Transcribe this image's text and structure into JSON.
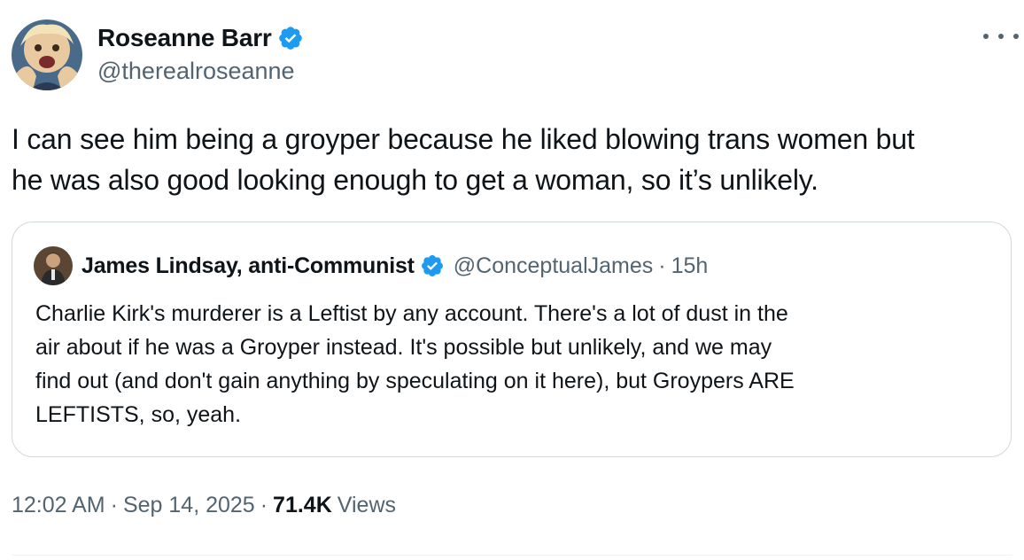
{
  "author": {
    "display_name": "Roseanne Barr",
    "handle": "@therealroseanne",
    "verified": true,
    "avatar_icon": "profile-photo"
  },
  "more_icon": "ellipsis-icon",
  "tweet": {
    "text_line1": "I can see him being a groyper because he liked blowing trans women but",
    "text_line2": "he was also good looking enough to get a woman, so it’s unlikely."
  },
  "quoted": {
    "display_name": "James Lindsay, anti-Communist",
    "handle": "@ConceptualJames",
    "separator": "·",
    "time": "15h",
    "verified": true,
    "text_lines": [
      "Charlie Kirk's murderer is a Leftist by any account. There's a lot of dust in the",
      "air about if he was a Groyper instead. It's possible but unlikely, and we may",
      "find out (and don't gain anything by speculating on it here), but Groypers ARE",
      "LEFTISTS, so, yeah."
    ]
  },
  "meta": {
    "time": "12:02 AM",
    "separator": "·",
    "date": "Sep 14, 2025",
    "views_count": "71.4K",
    "views_label": "Views"
  },
  "colors": {
    "verified_blue": "#1d9bf0",
    "text_primary": "#0f1419",
    "text_secondary": "#536471",
    "border": "#cfd9de"
  }
}
